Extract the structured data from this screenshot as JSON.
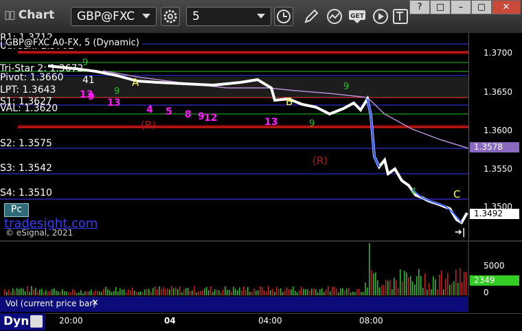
{
  "toolbar": {
    "title": "Chart",
    "symbol": "GBP@FXC",
    "interval": "5",
    "window_buttons": [
      "?",
      "□",
      "–",
      "▢",
      "✕"
    ]
  },
  "chart": {
    "symbol_line": "GBP@FXC A0-FX, 5 (Dynamic)",
    "levels": [
      {
        "label": "R1: 1.3712",
        "color": "#3d3dff"
      },
      {
        "label": "Ubreak: 1.3702",
        "color": "#ff3a3a"
      },
      {
        "label": "Tri-Star 2: 1.3672",
        "color": "#25c425"
      },
      {
        "label": "Pivot: 1.3660",
        "color": "#3d3dff"
      },
      {
        "label": "LPT: 1.3643",
        "color": "#ff3a3a"
      },
      {
        "label": "S1: 1.3627",
        "color": "#3d3dff"
      },
      {
        "label": "VAL: 1.3620",
        "color": "#25c425"
      },
      {
        "label": "S2: 1.3575",
        "color": "#3d3dff"
      },
      {
        "label": "S3: 1.3542",
        "color": "#3d3dff"
      },
      {
        "label": "S4: 1.3510",
        "color": "#3d3dff"
      }
    ],
    "y_ticks": [
      "1.3700",
      "1.3650",
      "1.3600",
      "1.3550",
      "1.3500"
    ],
    "price_tags": {
      "avg": "1.3578",
      "last": "1.3492"
    },
    "annotations": {
      "A": "A",
      "B": "B",
      "C": "C",
      "R1": "(R)",
      "R2": "(R)",
      "n4": "4",
      "n5": "5",
      "n8": "8",
      "n9": "9",
      "n12": "12",
      "n13a": "13",
      "n13b": "13",
      "n9a": "9",
      "n13c": "13",
      "g9a": "9",
      "g9b": "9",
      "g9c": "9",
      "g9d": "9",
      "g4": "4",
      "n41": "41"
    },
    "brand": "tradesight.com",
    "badge": "Pc",
    "copyright": "© eSignal, 2021"
  },
  "volume": {
    "label": "Vol (current price bar)",
    "y_ticks": [
      "5000",
      "0"
    ],
    "last_tag": "2349"
  },
  "xaxis": {
    "label": "Dyn",
    "ticks": [
      "20:00",
      "04",
      "04:00",
      "08:00"
    ]
  },
  "colors": {
    "support": "#3d3dff",
    "lpt": "#ff3a3a",
    "green": "#25c425",
    "magenta": "#ff1cff",
    "price": "#ffffff",
    "ma": "#b38ed6"
  }
}
